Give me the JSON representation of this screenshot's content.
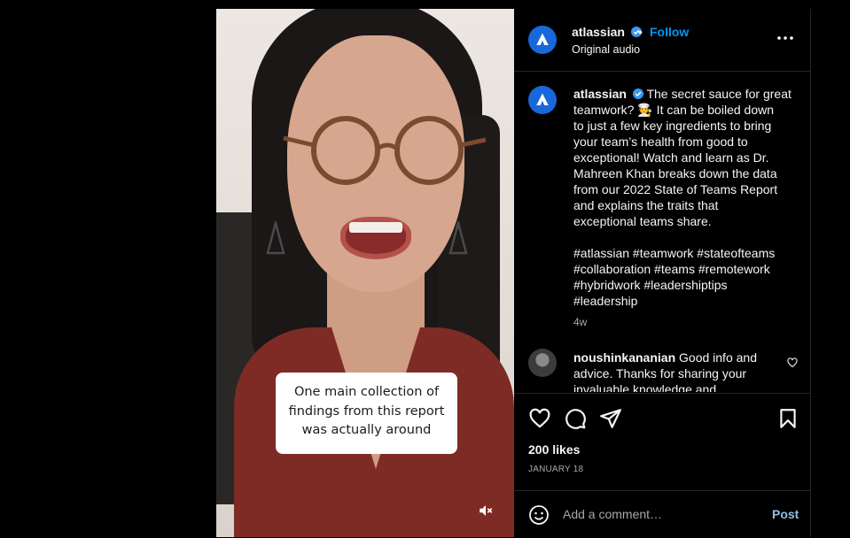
{
  "video": {
    "caption_lines": [
      "One main collection of",
      "findings from this report",
      "was actually around"
    ],
    "mute_icon": "speaker-muted-icon"
  },
  "header": {
    "username": "atlassian",
    "separator": "•",
    "follow_label": "Follow",
    "audio_label": "Original audio",
    "more_icon": "ellipsis-icon"
  },
  "caption": {
    "username": "atlassian",
    "first_line": "The secret sauce for great",
    "lines": [
      "teamwork? 🧑‍🍳 It can be boiled down",
      "to just a few key ingredients to bring",
      "your team’s health from good to",
      "exceptional! Watch and learn as Dr.",
      "Mahreen Khan breaks down the data",
      "from our 2022 State of Teams Report",
      "and explains the traits that",
      "exceptional teams share."
    ],
    "hashtag_lines": [
      "#atlassian #teamwork #stateofteams",
      "#collaboration #teams #remotework",
      "#hybridwork #leadershiptips",
      "#leadership"
    ],
    "time": "4w"
  },
  "comment": {
    "username": "noushinkananian",
    "first_line": "Good info and",
    "lines": [
      "advice. Thanks for sharing your",
      "invaluable knowledge and"
    ]
  },
  "actions": {
    "likes": "200 likes",
    "date": "JANUARY 18"
  },
  "comment_bar": {
    "placeholder": "Add a comment…",
    "post_label": "Post"
  },
  "colors": {
    "brand_blue": "#1868db",
    "link_blue": "#0095f6",
    "post_blue": "#8fbfe6",
    "verified_blue": "#3897f0",
    "muted_text": "#a8a8a8"
  }
}
